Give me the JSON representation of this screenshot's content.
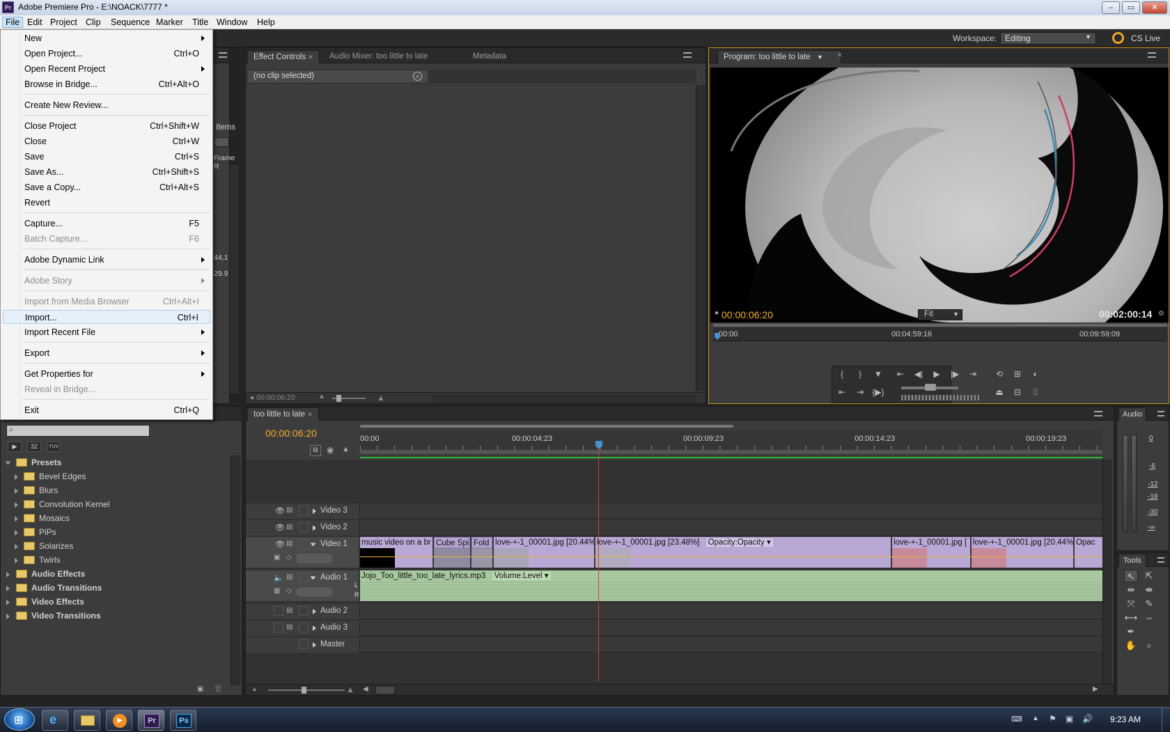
{
  "window": {
    "title": "Adobe Premiere Pro - E:\\NOACK\\7777 *",
    "app_icon": "Pr"
  },
  "menubar": [
    "File",
    "Edit",
    "Project",
    "Clip",
    "Sequence",
    "Marker",
    "Title",
    "Window",
    "Help"
  ],
  "workspace": {
    "label": "Workspace:",
    "value": "Editing",
    "cs_live": "CS Live"
  },
  "file_menu": [
    {
      "label": "New",
      "shortcut": "",
      "submenu": true,
      "disabled": false
    },
    {
      "label": "Open Project...",
      "shortcut": "Ctrl+O"
    },
    {
      "label": "Open Recent Project",
      "submenu": true
    },
    {
      "label": "Browse in Bridge...",
      "shortcut": "Ctrl+Alt+O"
    },
    {
      "label": "Create New Review..."
    },
    {
      "label": "Close Project",
      "shortcut": "Ctrl+Shift+W"
    },
    {
      "label": "Close",
      "shortcut": "Ctrl+W"
    },
    {
      "label": "Save",
      "shortcut": "Ctrl+S"
    },
    {
      "label": "Save As...",
      "shortcut": "Ctrl+Shift+S"
    },
    {
      "label": "Save a Copy...",
      "shortcut": "Ctrl+Alt+S"
    },
    {
      "label": "Revert"
    },
    {
      "label": "Capture...",
      "shortcut": "F5"
    },
    {
      "label": "Batch Capture...",
      "shortcut": "F6",
      "disabled": true
    },
    {
      "label": "Adobe Dynamic Link",
      "submenu": true
    },
    {
      "label": "Adobe Story",
      "submenu": true,
      "disabled": true
    },
    {
      "label": "Import from Media Browser",
      "shortcut": "Ctrl+Alt+I",
      "disabled": true
    },
    {
      "label": "Import...",
      "shortcut": "Ctrl+I",
      "highlighted": true
    },
    {
      "label": "Import Recent File",
      "submenu": true
    },
    {
      "label": "Export",
      "submenu": true
    },
    {
      "label": "Get Properties for",
      "submenu": true
    },
    {
      "label": "Reveal in Bridge...",
      "disabled": true
    },
    {
      "label": "Exit",
      "shortcut": "Ctrl+Q"
    }
  ],
  "project_panel_fragments": {
    "items": "Items",
    "frame": "Frame R",
    "v1": "44,1",
    "v2": "29.9"
  },
  "effect_controls": {
    "tabs": [
      "Effect Controls",
      "Audio Mixer: too little to late",
      "Metadata"
    ],
    "no_clip": "(no clip selected)",
    "timecode": "00:00:06:20"
  },
  "program_monitor": {
    "tab": "Program: too little to late",
    "timecode": "00:00:06:20",
    "fit": "Fit",
    "duration": "00:02:00:14",
    "ruler": [
      "00:00",
      "00:04:59:16",
      "00:09:59:09"
    ]
  },
  "effects_panel": {
    "tree": [
      {
        "label": "Presets",
        "level": 0,
        "open": true,
        "bold": true
      },
      {
        "label": "Bevel Edges",
        "level": 1
      },
      {
        "label": "Blurs",
        "level": 1
      },
      {
        "label": "Convolution Kernel",
        "level": 1
      },
      {
        "label": "Mosaics",
        "level": 1
      },
      {
        "label": "PiPs",
        "level": 1
      },
      {
        "label": "Solarizes",
        "level": 1
      },
      {
        "label": "Twirls",
        "level": 1
      },
      {
        "label": "Audio Effects",
        "level": 0,
        "bold": true
      },
      {
        "label": "Audio Transitions",
        "level": 0,
        "bold": true
      },
      {
        "label": "Video Effects",
        "level": 0,
        "bold": true
      },
      {
        "label": "Video Transitions",
        "level": 0,
        "bold": true
      }
    ],
    "buttons": [
      "32",
      "YUV"
    ]
  },
  "timeline": {
    "tab": "too little to late",
    "timecode": "00:00:06:20",
    "ruler": [
      "00:00",
      "00:00:04:23",
      "00:00:09:23",
      "00:00:14:23",
      "00:00:19:23"
    ],
    "tracks": [
      "Video 3",
      "Video 2",
      "Video 1",
      "Audio 1",
      "Audio 2",
      "Audio 3",
      "Master"
    ],
    "video1_clips": [
      "music video on a br",
      "Cube Spin",
      "Fold",
      "love-+-1_00001.jpg [20.44%",
      "love-+-1_00001.jpg [23.48%]",
      "Opacity:Opacity",
      "love-+-1_00001.jpg [",
      "love-+-1_00001.jpg [20.44%]",
      "Opac"
    ],
    "audio1_clip": "Jojo_Too_little_too_late_lyrics.mp3",
    "audio1_fx": "Volume:Level",
    "lr": [
      "L",
      "R"
    ]
  },
  "audio_meter": {
    "title": "Audio",
    "ticks": [
      "0",
      "-6",
      "-12",
      "-18",
      "-30",
      "-∞"
    ]
  },
  "tools": {
    "title": "Tools"
  },
  "taskbar": {
    "clock": "9:23 AM",
    "apps": [
      "ie",
      "explorer",
      "media",
      "premiere",
      "photoshop"
    ],
    "labels": {
      "pr": "Pr",
      "ps": "Ps"
    }
  }
}
